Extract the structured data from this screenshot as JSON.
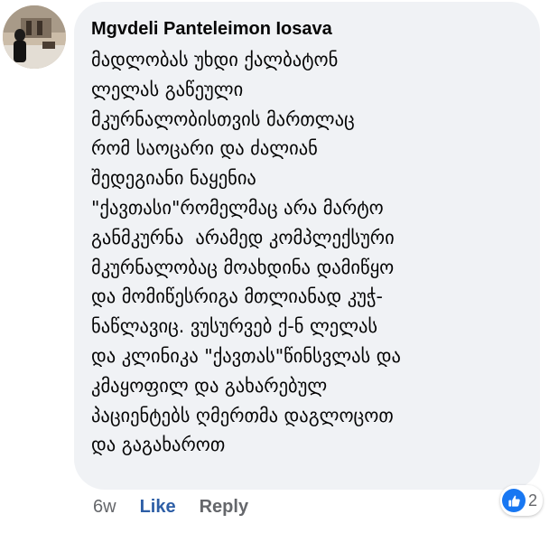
{
  "comment": {
    "author": "Mgvdeli Panteleimon Iosava",
    "lines": [
      "მადლობას უხდი ქალბატონ",
      "ლელას გაწეული",
      "მკურნალობისთვის მართლაც",
      "რომ საოცარი და ძალიან",
      "შედეგიანი ნაყენია",
      "\"ქავთასი\"რომელმაც არა მარტო",
      "განმკურნა  არამედ კომპლექსური",
      "მკურნალობაც მოახდინა დამიწყო",
      "და მომიწესრიგა მთლიანად კუჭ-",
      "ნაწლავიც. ვუსურვებ ქ-ნ ლელას",
      "და კლინიკა \"ქავთას\"წინსვლას და",
      "კმაყოფილ და გახარებულ",
      "პაციენტებს ღმერთმა დაგლოცოთ",
      "და გაგახაროთ"
    ]
  },
  "actions": {
    "timestamp": "6w",
    "like_label": "Like",
    "reply_label": "Reply"
  },
  "reactions": {
    "icon": "thumbs-up-icon",
    "count": "2",
    "color": "#1877f2"
  },
  "avatar": {
    "icon": "profile-photo"
  }
}
